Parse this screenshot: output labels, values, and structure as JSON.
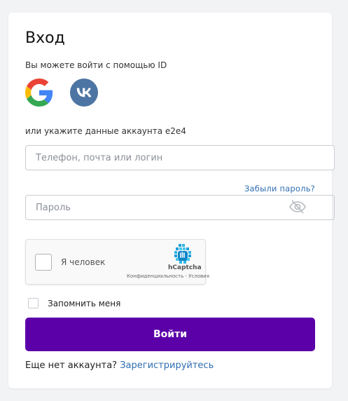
{
  "login": {
    "title": "Вход",
    "subtitle": "Вы можете войти с помощью ID",
    "alt_text": "или укажите данные аккаунта e2e4",
    "login_placeholder": "Телефон, почта или логин",
    "forgot_label": "Забыли пароль?",
    "password_placeholder": "Пароль",
    "remember_label": "Запомнить меня",
    "submit_label": "Войти",
    "register_prompt": "Еще нет аккаунта?",
    "register_link": "Зарегистрируйтесь"
  },
  "social": {
    "google_icon": "google-icon",
    "vk_icon": "vk-icon"
  },
  "captcha": {
    "label": "Я человек",
    "brand": "hCaptcha",
    "privacy": "Конфиденциальность",
    "separator": " - ",
    "terms": "Условия"
  },
  "colors": {
    "accent": "#5b00a8",
    "link": "#2f6db1",
    "vk": "#4c75a3"
  }
}
